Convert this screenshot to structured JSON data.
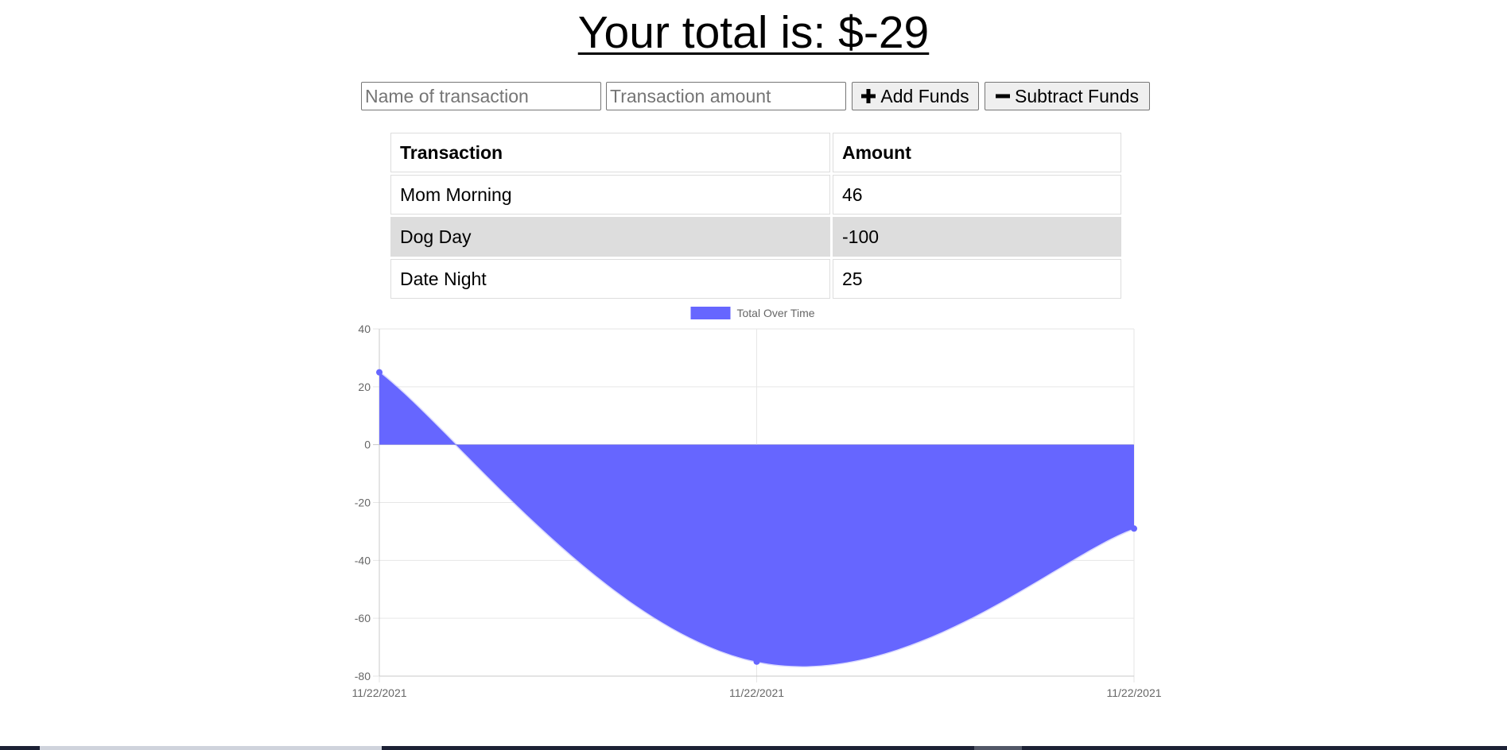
{
  "header": {
    "title": "Your total is: $-29"
  },
  "form": {
    "name_placeholder": "Name of transaction",
    "amount_placeholder": "Transaction amount",
    "add_label": "Add Funds",
    "subtract_label": "Subtract Funds",
    "add_icon": "plus-icon",
    "subtract_icon": "minus-icon"
  },
  "table": {
    "headers": [
      "Transaction",
      "Amount"
    ],
    "rows": [
      {
        "name": "Mom Morning",
        "amount": "46"
      },
      {
        "name": "Dog Day",
        "amount": "-100"
      },
      {
        "name": "Date Night",
        "amount": "25"
      }
    ]
  },
  "colors": {
    "fill": "#6666ff",
    "alt_row": "#dddddd"
  },
  "chart_data": {
    "type": "area",
    "categories": [
      "11/22/2021",
      "11/22/2021",
      "11/22/2021"
    ],
    "series": [
      {
        "name": "Total Over Time",
        "values": [
          25,
          -75,
          -29
        ]
      }
    ],
    "ylim": [
      -80,
      40
    ],
    "yticks": [
      40,
      20,
      0,
      -20,
      -40,
      -60,
      -80
    ],
    "grid": true,
    "legend": "top-center",
    "title": "",
    "xlabel": "",
    "ylabel": ""
  }
}
